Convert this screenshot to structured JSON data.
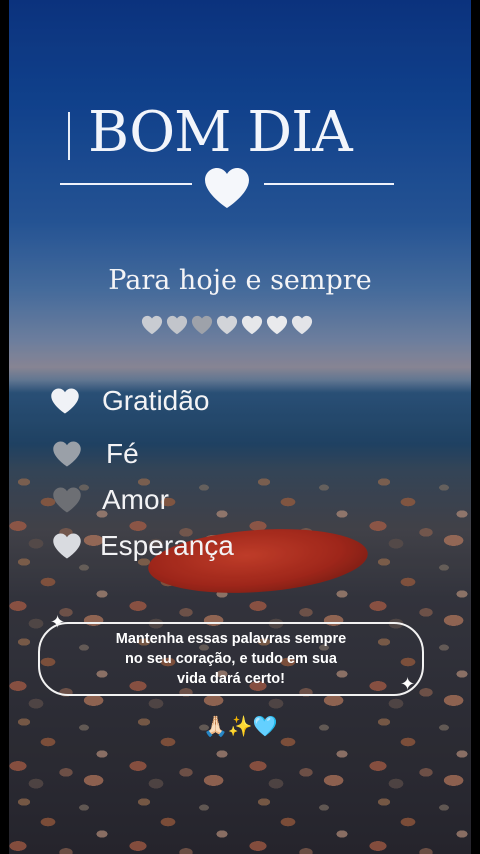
{
  "title": "BOM DIA",
  "subtitle": "Para hoje e sempre",
  "hearts_row_count": 7,
  "words": [
    {
      "label": "Gratidão",
      "icon": "heart-icon"
    },
    {
      "label": "Fé",
      "icon": "heart-icon"
    },
    {
      "label": "Amor",
      "icon": "heart-icon"
    },
    {
      "label": "Esperança",
      "icon": "heart-icon"
    }
  ],
  "message": {
    "line1": "Mantenha essas palavras sempre",
    "line2": "no seu coração, e tudo em sua",
    "line3": "vida dará certo!"
  },
  "emojis": "🙏🏻✨🩵",
  "colors": {
    "text": "#f2f5fb",
    "heart": "#eef1f6",
    "sky": "#134a9f"
  }
}
